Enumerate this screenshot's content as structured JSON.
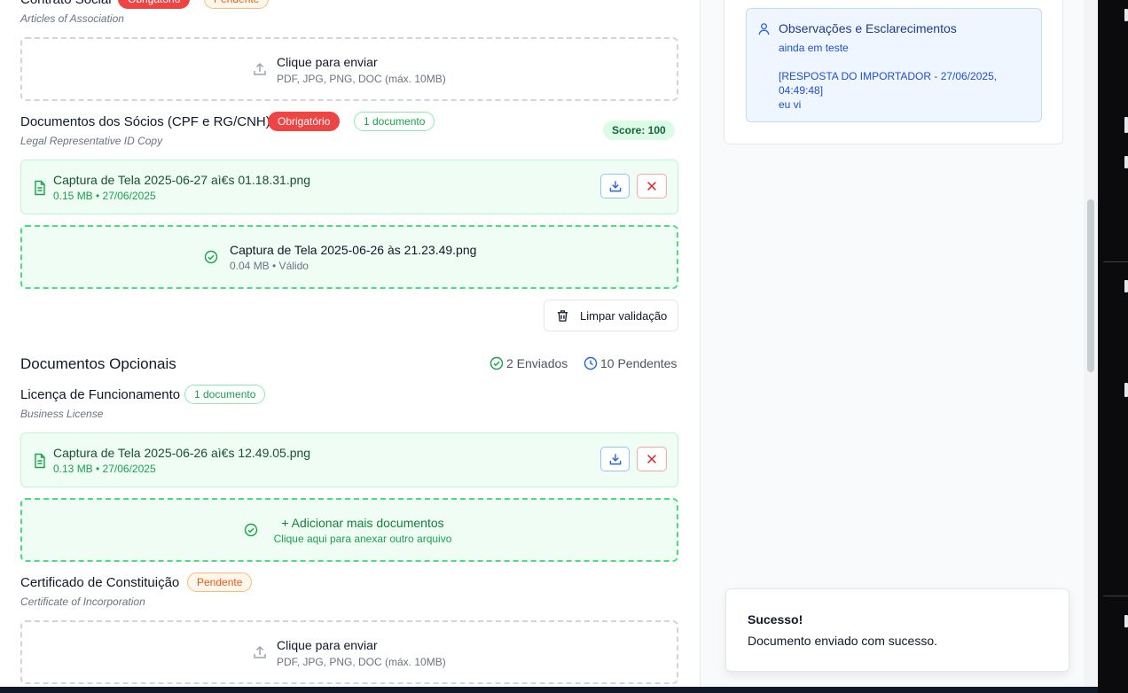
{
  "docs": {
    "contrato": {
      "title": "Contrato Social",
      "badge_required": "Obrigatório",
      "badge_status": "Pendente",
      "subtitle": "Articles of Association",
      "upload_label": "Clique para enviar",
      "upload_hint": "PDF, JPG, PNG, DOC (máx. 10MB)"
    },
    "socios": {
      "title": "Documentos dos Sócios (CPF e RG/CNH)",
      "badge_required": "Obrigatório",
      "badge_count": "1 documento",
      "subtitle": "Legal Representative ID Copy",
      "score": "Score: 100",
      "file_name": "Captura de Tela 2025-06-27 aì€s 01.18.31.png",
      "file_meta": "0.15 MB • 27/06/2025",
      "validated_name": "Captura de Tela 2025-06-26 às 21.23.49.png",
      "validated_meta": "0.04 MB • Válido",
      "clear_label": "Limpar validação"
    },
    "optional": {
      "title": "Documentos Opcionais",
      "sent": "2 Enviados",
      "pending": "10 Pendentes"
    },
    "licenca": {
      "title": "Licença de Funcionamento",
      "badge_count": "1 documento",
      "subtitle": "Business License",
      "file_name": "Captura de Tela 2025-06-26 aì€s 12.49.05.png",
      "file_meta": "0.13 MB • 27/06/2025",
      "add_label": "+ Adicionar mais documentos",
      "add_hint": "Clique aqui para anexar outro arquivo"
    },
    "certificado": {
      "title": "Certificado de Constituição",
      "badge_status": "Pendente",
      "subtitle": "Certificate of Incorporation",
      "upload_label": "Clique para enviar",
      "upload_hint": "PDF, JPG, PNG, DOC (máx. 10MB)"
    }
  },
  "observations": {
    "title": "Observações e Esclarecimentos",
    "line1": "ainda em teste",
    "line2": "[RESPOSTA DO IMPORTADOR - 27/06/2025,",
    "line3": "04:49:48]",
    "line4": "eu vi"
  },
  "toast": {
    "title": "Sucesso!",
    "message": "Documento enviado com sucesso."
  },
  "colors": {
    "required": "#ef4444",
    "pending": "#ea580c",
    "success": "#16a34a",
    "info": "#1d4ed8"
  },
  "icons": [
    "upload-icon",
    "file-icon",
    "download-icon",
    "close-icon",
    "check-circle-icon",
    "trash-icon",
    "clock-icon",
    "user-icon"
  ]
}
